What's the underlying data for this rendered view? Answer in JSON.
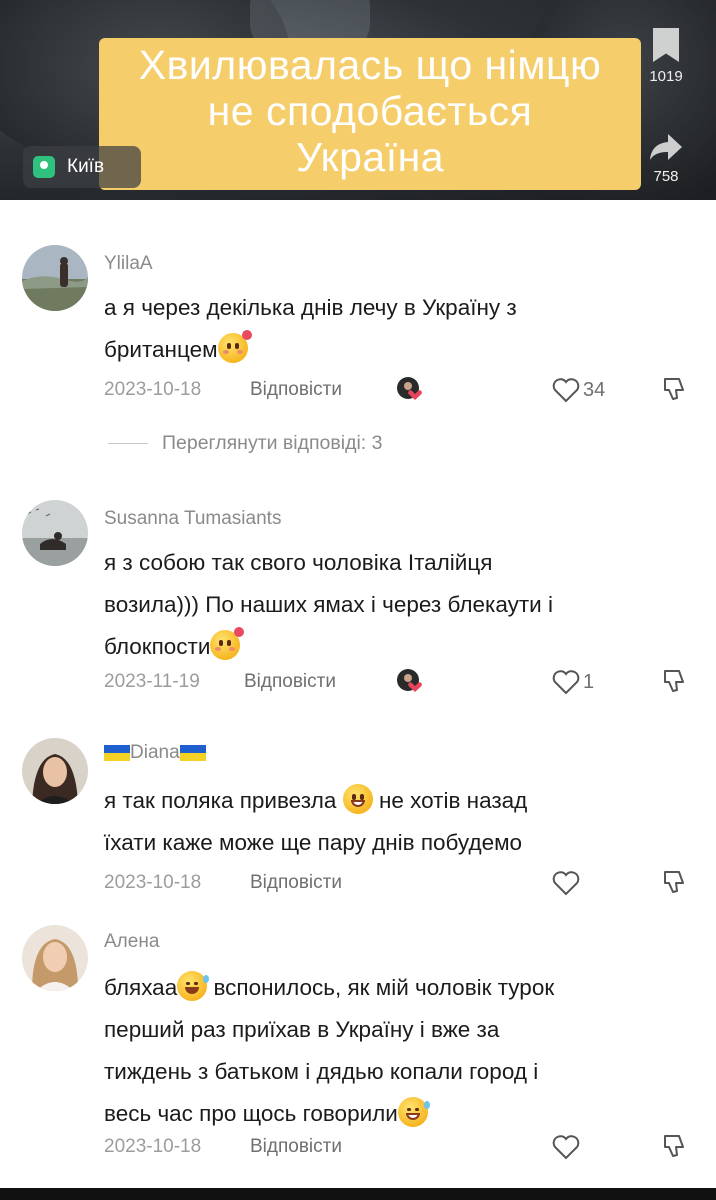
{
  "video": {
    "caption_lines": [
      "Хвилювалась що німцю",
      "не сподобається",
      "Україна"
    ],
    "location": "Київ",
    "bookmark_count": "1019",
    "share_count": "758",
    "caption_color": "#f5cd6a"
  },
  "comments": [
    {
      "username": "YlilaA",
      "text_lines": [
        "а я через декілька днів лечу в Україну з",
        "британцем"
      ],
      "emoji": "smiling-face-with-hearts",
      "date": "2023-10-18",
      "reply_label": "Відповісти",
      "likes": "34",
      "creator_liked": true,
      "view_replies": "Переглянути відповіді: 3"
    },
    {
      "username": "Susanna Tumasiants",
      "text_lines": [
        "я з собою так свого чоловіка Італійця",
        "возила))) По наших ямах і через блекаути і",
        "блокпости"
      ],
      "emoji": "smiling-face-with-hearts",
      "date": "2023-11-19",
      "reply_label": "Відповісти",
      "likes": "1",
      "creator_liked": true
    },
    {
      "username": "Diana",
      "username_flags": true,
      "text_lines": [
        "я так поляка привезла",
        "не хотів назад",
        "їхати каже може ще пару днів побудемо"
      ],
      "emoji": "grinning-face",
      "date": "2023-10-18",
      "reply_label": "Відповісти",
      "likes": ""
    },
    {
      "username": "Алена",
      "text_lines": [
        "бляхаа",
        "вспонилось, як мій чоловік турок",
        "перший раз приїхав в Україну і вже за",
        "тиждень з батьком і дядью копали город і",
        "весь час про щось говорили"
      ],
      "emoji": "laughing-face",
      "date": "2023-10-18",
      "reply_label": "Відповісти",
      "likes": ""
    }
  ],
  "icons": {
    "location": "map-pin-icon",
    "bookmark": "bookmark-icon",
    "share": "share-arrow-icon",
    "like": "heart-outline-icon",
    "dislike": "thumbs-down-icon"
  }
}
